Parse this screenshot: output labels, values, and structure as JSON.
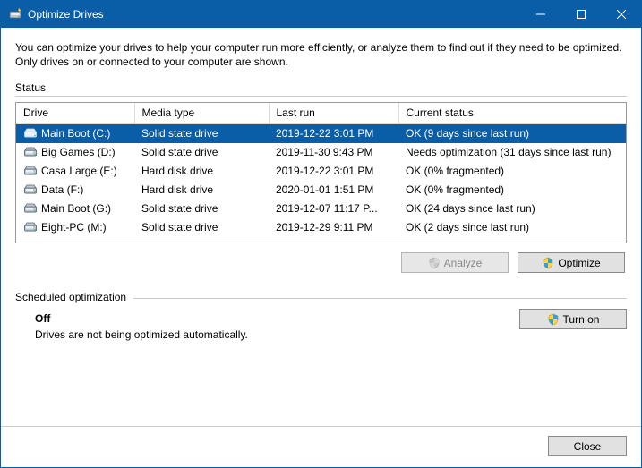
{
  "window": {
    "title": "Optimize Drives"
  },
  "intro": "You can optimize your drives to help your computer run more efficiently, or analyze them to find out if they need to be optimized. Only drives on or connected to your computer are shown.",
  "status_label": "Status",
  "columns": {
    "drive": "Drive",
    "media": "Media type",
    "lastrun": "Last run",
    "status": "Current status"
  },
  "drives": [
    {
      "name": "Main Boot (C:)",
      "media": "Solid state drive",
      "lastrun": "2019-12-22 3:01 PM",
      "status": "OK (9 days since last run)",
      "selected": true,
      "icon": "ssd"
    },
    {
      "name": "Big Games (D:)",
      "media": "Solid state drive",
      "lastrun": "2019-11-30 9:43 PM",
      "status": "Needs optimization (31 days since last run)",
      "selected": false,
      "icon": "ssd"
    },
    {
      "name": "Casa Large (E:)",
      "media": "Hard disk drive",
      "lastrun": "2019-12-22 3:01 PM",
      "status": "OK (0% fragmented)",
      "selected": false,
      "icon": "hdd"
    },
    {
      "name": "Data (F:)",
      "media": "Hard disk drive",
      "lastrun": "2020-01-01 1:51 PM",
      "status": "OK (0% fragmented)",
      "selected": false,
      "icon": "hdd"
    },
    {
      "name": "Main Boot (G:)",
      "media": "Solid state drive",
      "lastrun": "2019-12-07 11:17 P...",
      "status": "OK (24 days since last run)",
      "selected": false,
      "icon": "ssd"
    },
    {
      "name": "Eight-PC (M:)",
      "media": "Solid state drive",
      "lastrun": "2019-12-29 9:11 PM",
      "status": "OK (2 days since last run)",
      "selected": false,
      "icon": "ssd"
    }
  ],
  "buttons": {
    "analyze": "Analyze",
    "optimize": "Optimize",
    "turn_on": "Turn on",
    "close": "Close"
  },
  "sched": {
    "label": "Scheduled optimization",
    "status": "Off",
    "note": "Drives are not being optimized automatically."
  }
}
